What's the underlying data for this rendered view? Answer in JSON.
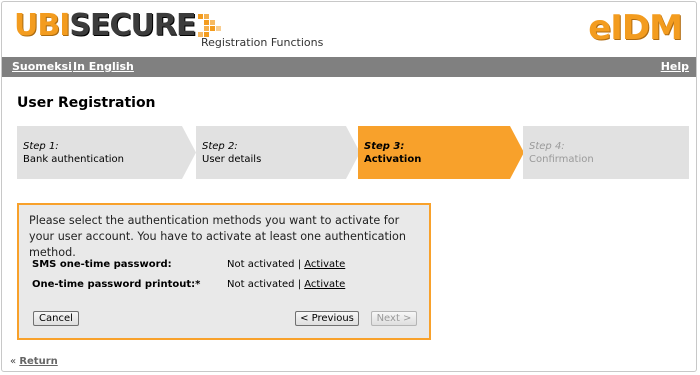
{
  "header": {
    "logo_part1": "UBI",
    "logo_part2": "SECURE",
    "subtitle": "Registration Functions",
    "product": "eIDM"
  },
  "nav": {
    "lang_fi": "Suomeksi",
    "lang_en": "In English",
    "help": "Help"
  },
  "page": {
    "title": "User Registration"
  },
  "steps": [
    {
      "num": "Step 1:",
      "label": "Bank authentication",
      "state": "done"
    },
    {
      "num": "Step 2:",
      "label": "User details",
      "state": "done"
    },
    {
      "num": "Step 3:",
      "label": "Activation",
      "state": "active"
    },
    {
      "num": "Step 4:",
      "label": "Confirmation",
      "state": "disabled"
    }
  ],
  "panel": {
    "instructions": "Please select the authentication methods you want to activate for your user account. You have to activate at least one authentication method.",
    "methods": [
      {
        "name": "SMS one-time password:",
        "status": "Not activated",
        "separator": "|",
        "action": "Activate"
      },
      {
        "name": "One-time password printout:*",
        "status": "Not activated",
        "separator": "|",
        "action": "Activate"
      }
    ],
    "cancel": "Cancel",
    "previous": "< Previous",
    "next": "Next >"
  },
  "footer": {
    "prefix": "«",
    "return": "Return"
  },
  "colors": {
    "accent": "#f8a12b",
    "navbar": "#808080",
    "step_bg": "#e1e1e1",
    "panel_bg": "#e9e9e9"
  }
}
